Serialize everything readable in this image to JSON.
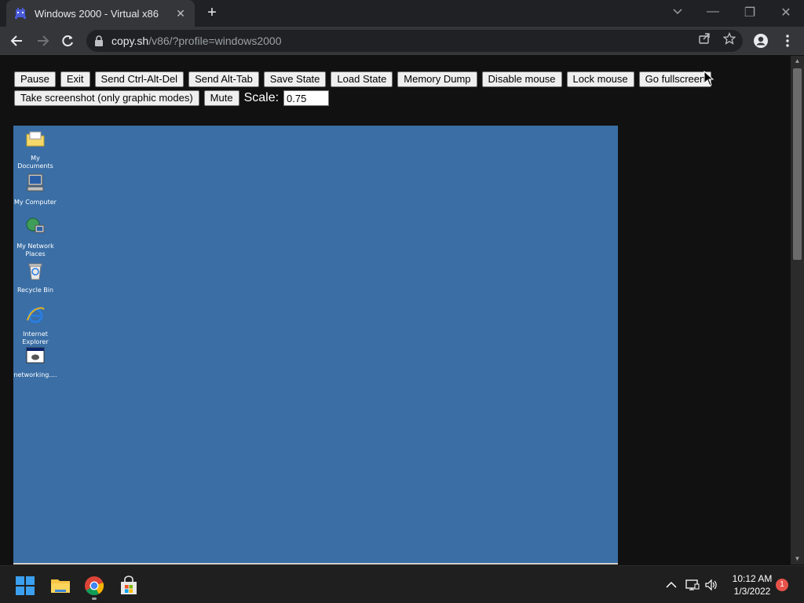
{
  "browser": {
    "tab_title": "Windows 2000 - Virtual x86",
    "tab_close": "✕",
    "new_tab": "+",
    "url_host": "copy.sh",
    "url_path": "/v86/?profile=windows2000",
    "window_controls": {
      "minimize": "—",
      "restore": "❐",
      "close": "✕"
    }
  },
  "controls": {
    "row1": [
      "Pause",
      "Exit",
      "Send Ctrl-Alt-Del",
      "Send Alt-Tab",
      "Save State",
      "Load State",
      "Memory Dump",
      "Disable mouse",
      "Lock mouse",
      "Go fullscreen"
    ],
    "row2": [
      "Take screenshot (only graphic modes)",
      "Mute"
    ],
    "scale_label": "Scale:",
    "scale_value": "0.75"
  },
  "desktop": {
    "icons": [
      {
        "label": "My Documents",
        "icon": "folder-icon"
      },
      {
        "label": "My Computer",
        "icon": "computer-icon"
      },
      {
        "label": "My Network Places",
        "icon": "network-icon"
      },
      {
        "label": "Recycle Bin",
        "icon": "recycle-bin-icon"
      },
      {
        "label": "Internet Explorer",
        "icon": "internet-explorer-icon"
      },
      {
        "label": "networking....",
        "icon": "program-icon"
      }
    ],
    "background_color": "#3a6ea5"
  },
  "taskbar": {
    "apps": [
      "start-icon",
      "file-explorer-icon",
      "chrome-icon",
      "store-icon"
    ],
    "clock_time": "10:12 AM",
    "clock_date": "1/3/2022",
    "notification_count": "1"
  }
}
